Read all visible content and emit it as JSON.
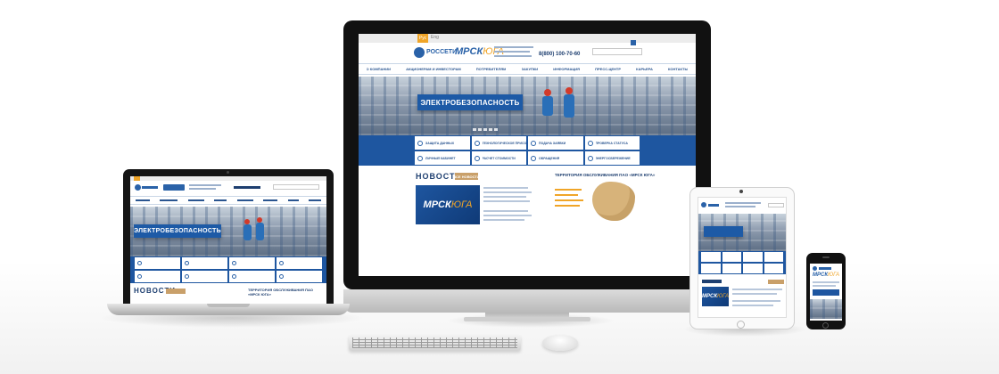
{
  "desktop": {
    "lang": "Рус",
    "lang_alt": "Eng",
    "logo_rosseti": "РОССЕТИ",
    "logo_mrsk_a": "МРСК",
    "logo_mrsk_b": "ЮГА",
    "hotline": "8(800) 100-70-60",
    "menu": [
      "О компании",
      "Акционерам и инвесторам",
      "Потребителям",
      "Закупки",
      "Информация",
      "Пресс-центр",
      "Карьера",
      "Контакты"
    ],
    "banner_title": "ЭЛЕКТРОБЕЗОПАСНОСТЬ",
    "services": [
      "Защита данных",
      "Технологическое присоединение",
      "Подача заявки",
      "Проверка статуса",
      "Личный кабинет",
      "Расчет стоимости",
      "Обращения",
      "Энергосбережение"
    ],
    "news_heading": "НОВОСТИ",
    "all_news": "ВСЕ НОВОСТИ",
    "news_image_a": "МРСК",
    "news_image_b": "ЮГА",
    "territory": "ТЕРРИТОРИЯ ОБСЛУЖИВАНИЯ ПАО «МРСК ЮГА»"
  },
  "laptop": {
    "banner_title": "ЭЛЕКТРОБЕЗОПАСНОСТЬ",
    "news_heading": "НОВОСТИ",
    "territory": "ТЕРРИТОРИЯ ОБСЛУЖИВАНИЯ ПАО «МРСК ЮГА»"
  },
  "tablet": {
    "mrsk_a": "МРСК",
    "mrsk_b": "ЮГА"
  },
  "phone": {
    "mrsk_a": "МРСК",
    "mrsk_b": "ЮГА"
  },
  "colors": {
    "brand_blue": "#1e56a0",
    "accent_orange": "#f0a528",
    "device_black": "#111111"
  }
}
